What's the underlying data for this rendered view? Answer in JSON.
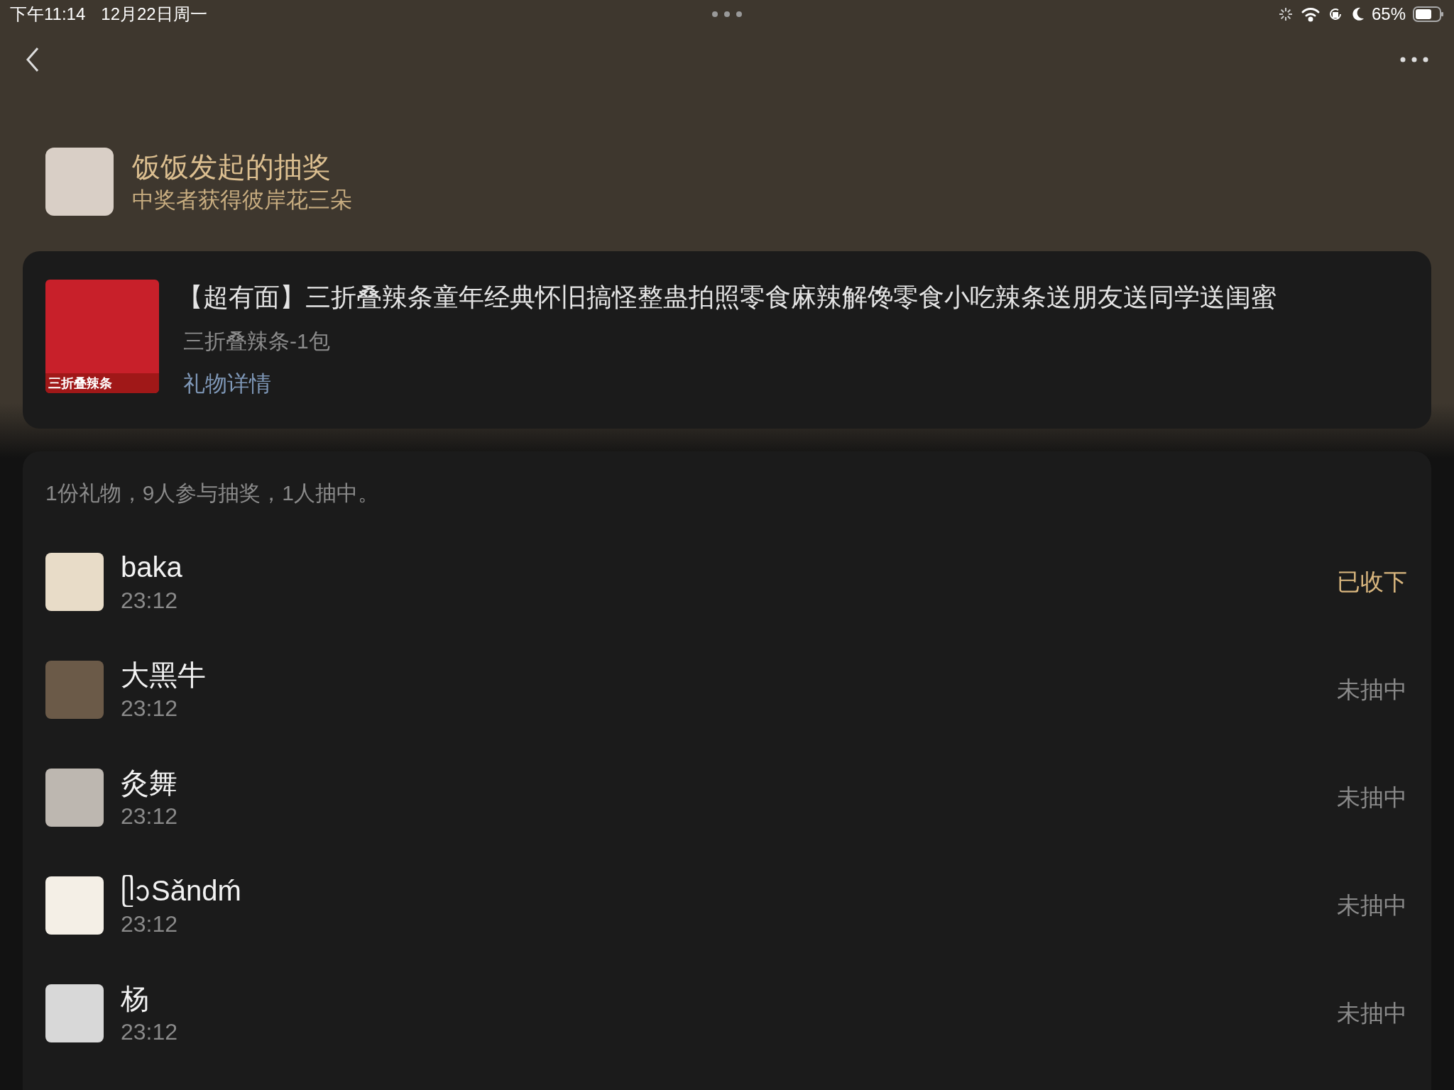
{
  "status_bar": {
    "time": "下午11:14",
    "date": "12月22日周一",
    "battery": "65%"
  },
  "header": {
    "title": "饭饭发起的抽奖",
    "subtitle": "中奖者获得彼岸花三朵"
  },
  "gift": {
    "title": "【超有面】三折叠辣条童年经典怀旧搞怪整蛊拍照零食麻辣解馋零食小吃辣条送朋友送同学送闺蜜",
    "variant": "三折叠辣条-1包",
    "link": "礼物详情",
    "image_badge": "三折叠辣条"
  },
  "summary": "1份礼物，9人参与抽奖，1人抽中。",
  "participants": [
    {
      "name": "baka",
      "time": "23:12",
      "status": "已收下",
      "kind": "received"
    },
    {
      "name": "大黑牛",
      "time": "23:12",
      "status": "未抽中",
      "kind": "lost"
    },
    {
      "name": "灸舞",
      "time": "23:12",
      "status": "未抽中",
      "kind": "lost"
    },
    {
      "name": "ᥫᩣSǎndḿ",
      "time": "23:12",
      "status": "未抽中",
      "kind": "lost"
    },
    {
      "name": "杨",
      "time": "23:12",
      "status": "未抽中",
      "kind": "lost"
    }
  ]
}
